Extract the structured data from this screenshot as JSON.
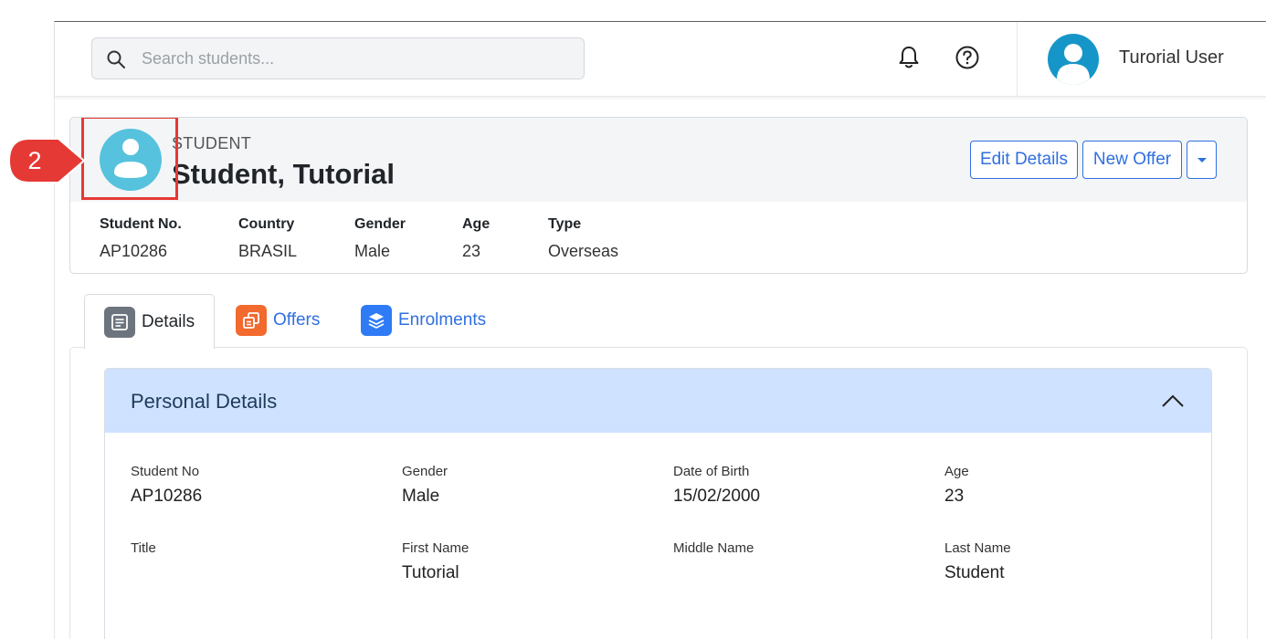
{
  "search": {
    "placeholder": "Search students..."
  },
  "user": {
    "name": "Turorial User"
  },
  "student": {
    "kind_label": "STUDENT",
    "display_name": "Student, Tutorial",
    "meta": [
      {
        "label": "Student No.",
        "value": "AP10286"
      },
      {
        "label": "Country",
        "value": "BRASIL"
      },
      {
        "label": "Gender",
        "value": "Male"
      },
      {
        "label": "Age",
        "value": "23"
      },
      {
        "label": "Type",
        "value": "Overseas"
      }
    ]
  },
  "actions": {
    "edit_label": "Edit Details",
    "offer_label": "New Offer"
  },
  "tabs": [
    {
      "label": "Details",
      "icon": "document-icon"
    },
    {
      "label": "Offers",
      "icon": "offers-icon"
    },
    {
      "label": "Enrolments",
      "icon": "layers-icon"
    }
  ],
  "panel": {
    "title": "Personal Details",
    "fields": [
      {
        "label": "Student No",
        "value": "AP10286"
      },
      {
        "label": "Gender",
        "value": "Male"
      },
      {
        "label": "Date of Birth",
        "value": "15/02/2000"
      },
      {
        "label": "Age",
        "value": "23"
      },
      {
        "label": "Title",
        "value": ""
      },
      {
        "label": "First Name",
        "value": "Tutorial"
      },
      {
        "label": "Middle Name",
        "value": ""
      },
      {
        "label": "Last Name",
        "value": "Student"
      }
    ]
  },
  "callout": {
    "number": "2"
  },
  "colors": {
    "accent": "#2f6fe0",
    "avatar": "#1696c8",
    "student_avatar": "#56c2dd",
    "panel_header": "#cfe2ff",
    "highlight": "#e53935",
    "offers_icon": "#f26a2e",
    "enrol_icon": "#2f7bf5",
    "details_icon": "#6c757d"
  }
}
